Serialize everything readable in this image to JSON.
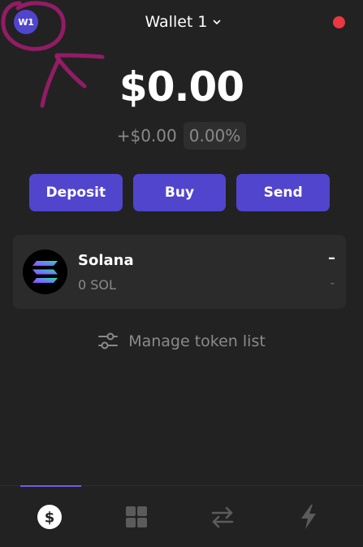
{
  "header": {
    "avatar_initials": "W1",
    "wallet_name": "Wallet 1",
    "status_color": "#eb3742"
  },
  "balance": {
    "total": "$0.00",
    "change_amount": "+$0.00",
    "change_percent": "0.00%"
  },
  "actions": [
    {
      "label": "Deposit"
    },
    {
      "label": "Buy"
    },
    {
      "label": "Send"
    }
  ],
  "tokens": [
    {
      "name": "Solana",
      "amount": "0 SOL",
      "value": "–",
      "change": "-",
      "icon": "solana-logo"
    }
  ],
  "manage": {
    "label": "Manage token list",
    "icon": "sliders-icon"
  },
  "bottom_nav": {
    "items": [
      {
        "icon": "dollar-icon",
        "active": true
      },
      {
        "icon": "grid-icon",
        "active": false
      },
      {
        "icon": "swap-arrows-icon",
        "active": false
      },
      {
        "icon": "lightning-icon",
        "active": false
      }
    ]
  },
  "colors": {
    "accent": "#5145cd",
    "background": "#222222",
    "card": "#2b2b2b",
    "muted_text": "#8a8a8a",
    "annotation": "#9c1c6b"
  }
}
